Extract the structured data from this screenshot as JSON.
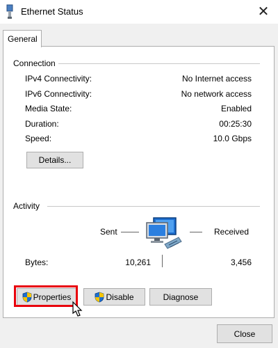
{
  "window": {
    "title": "Ethernet Status",
    "close_glyph": "✕"
  },
  "tabs": [
    {
      "label": "General"
    }
  ],
  "connection": {
    "group_label": "Connection",
    "rows": [
      {
        "label": "IPv4 Connectivity:",
        "value": "No Internet access"
      },
      {
        "label": "IPv6 Connectivity:",
        "value": "No network access"
      },
      {
        "label": "Media State:",
        "value": "Enabled"
      },
      {
        "label": "Duration:",
        "value": "00:25:30"
      },
      {
        "label": "Speed:",
        "value": "10.0 Gbps"
      }
    ],
    "details_label": "Details..."
  },
  "activity": {
    "group_label": "Activity",
    "sent_label": "Sent",
    "received_label": "Received",
    "bytes_label": "Bytes:",
    "bytes_sent": "10,261",
    "bytes_received": "3,456"
  },
  "buttons": {
    "properties": "Properties",
    "disable": "Disable",
    "diagnose": "Diagnose",
    "close": "Close"
  },
  "icons": {
    "title": "ethernet-adapter-icon",
    "shield": "uac-shield-icon",
    "network": "network-computers-icon",
    "cursor": "mouse-pointer-icon"
  },
  "colors": {
    "highlight": "#e8000b",
    "accent_blue": "#1e6fd0"
  }
}
